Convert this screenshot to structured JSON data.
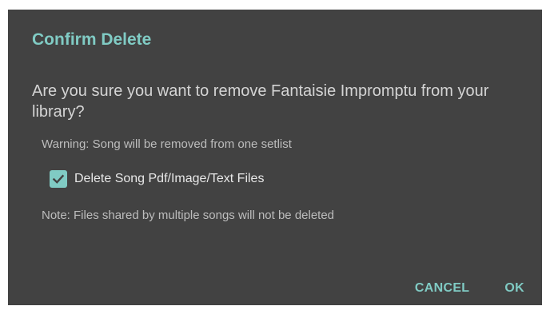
{
  "dialog": {
    "title": "Confirm Delete",
    "message": "Are you sure you want to remove Fantaisie Impromptu from your library?",
    "warning": "Warning: Song will be removed from one setlist",
    "checkbox": {
      "label": "Delete Song Pdf/Image/Text Files",
      "checked": true,
      "icon": "check-icon"
    },
    "note": "Note: Files shared by multiple songs will not be deleted",
    "actions": {
      "cancel_label": "CANCEL",
      "ok_label": "OK"
    }
  },
  "colors": {
    "dialog_background": "#424242",
    "accent": "#80cbc4",
    "primary_text": "#d4d4d4",
    "secondary_text": "#bdbdbd"
  }
}
